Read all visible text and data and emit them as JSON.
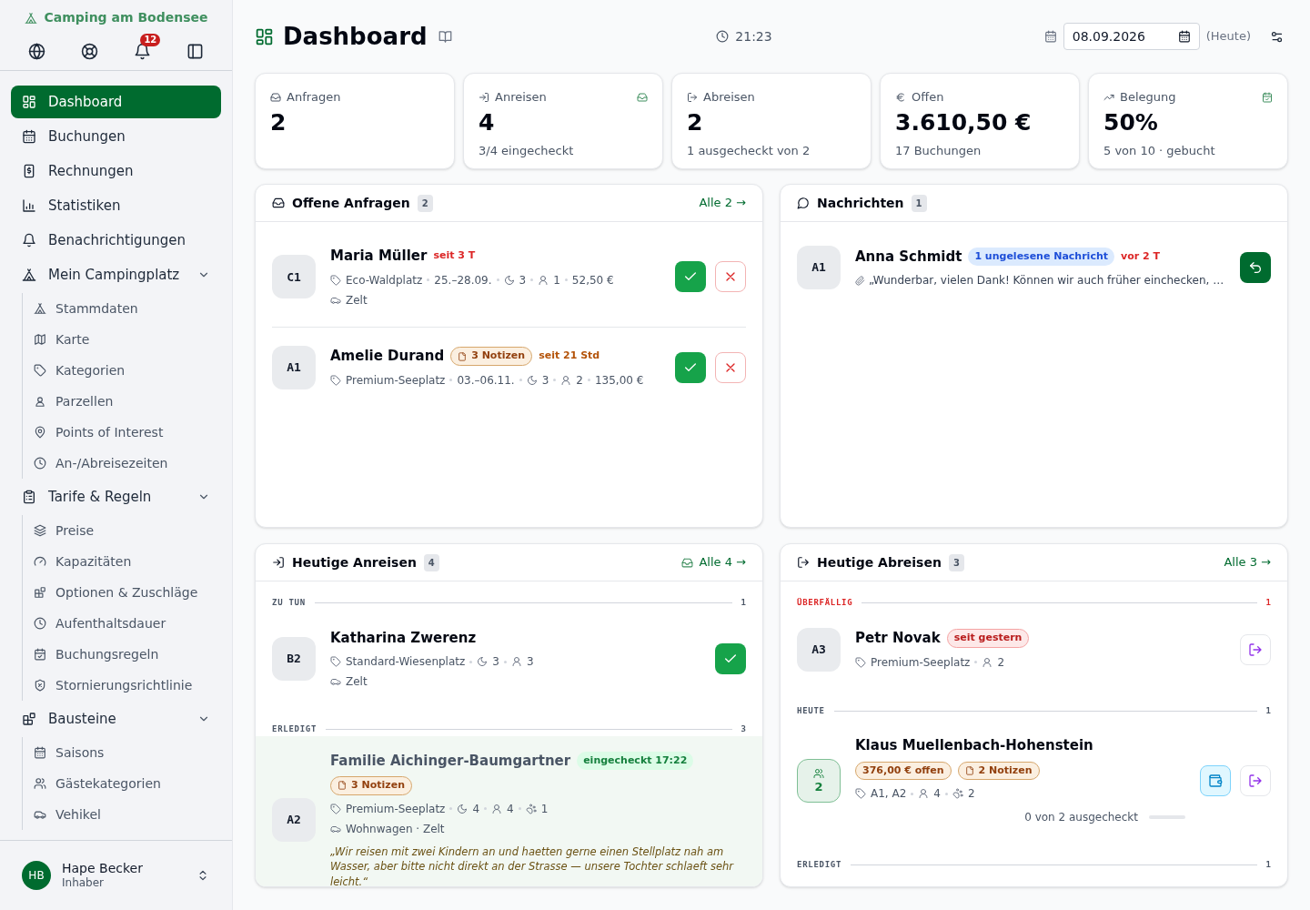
{
  "sidebar": {
    "brand": "Camping am Bodensee",
    "notification_count": "12",
    "nav": [
      {
        "label": "Dashboard",
        "selected": true
      },
      {
        "label": "Buchungen",
        "selected": false
      },
      {
        "label": "Rechnungen",
        "selected": false
      },
      {
        "label": "Statistiken",
        "selected": false
      },
      {
        "label": "Benachrichtigungen",
        "selected": false
      },
      {
        "label": "Mein Campingplatz",
        "selected": false,
        "expanded": true,
        "children": [
          {
            "label": "Stammdaten",
            "selected": false
          },
          {
            "label": "Karte",
            "selected": false
          },
          {
            "label": "Kategorien",
            "selected": false
          },
          {
            "label": "Parzellen",
            "selected": false
          },
          {
            "label": "Points of Interest",
            "selected": false
          },
          {
            "label": "An-/Abreisezeiten",
            "selected": false
          }
        ]
      },
      {
        "label": "Tarife & Regeln",
        "selected": false,
        "expanded": true,
        "children": [
          {
            "label": "Preise",
            "selected": false
          },
          {
            "label": "Kapazitäten",
            "selected": false
          },
          {
            "label": "Optionen & Zuschläge",
            "selected": false
          },
          {
            "label": "Aufenthaltsdauer",
            "selected": false
          },
          {
            "label": "Buchungsregeln",
            "selected": false
          },
          {
            "label": "Stornierungsrichtlinie",
            "selected": false
          }
        ]
      },
      {
        "label": "Bausteine",
        "selected": false,
        "expanded": true,
        "children": [
          {
            "label": "Saisons",
            "selected": false
          },
          {
            "label": "Gästekategorien",
            "selected": false
          },
          {
            "label": "Vehikel",
            "selected": false
          }
        ]
      }
    ],
    "user": {
      "initials": "HB",
      "name": "Hape Becker",
      "role": "Inhaber"
    }
  },
  "header": {
    "title": "Dashboard",
    "time": "21:23",
    "date": "08.09.2026",
    "date_note": "(Heute)"
  },
  "stats": [
    {
      "label": "Anfragen",
      "value": "2"
    },
    {
      "label": "Anreisen",
      "value": "4",
      "note": "3/4 eingecheckt"
    },
    {
      "label": "Abreisen",
      "value": "2",
      "note": "1 ausgecheckt von 2"
    },
    {
      "label": "Offen",
      "value": "3.610,50 €",
      "note": "17 Buchungen"
    },
    {
      "label": "Belegung",
      "value": "50%",
      "note": "5 von 10 · gebucht"
    }
  ],
  "panels": [
    {
      "kind": "requests",
      "title": "Offene Anfragen",
      "count": "2",
      "link": "Alle 2 →",
      "sections": [
        {
          "items": [
            {
              "spot": "C1",
              "group": false,
              "name": "Maria Müller",
              "done": false,
              "badges": [
                {
                  "kind": "urgent",
                  "text": "seit 3 T"
                }
              ],
              "meta": [
                {
                  "kind": "category",
                  "text": "Eco-Waldplatz"
                },
                {
                  "kind": "dates",
                  "text": "25.–28.09."
                },
                {
                  "kind": "nights",
                  "text": "3"
                },
                {
                  "kind": "persons",
                  "text": "1"
                },
                {
                  "kind": "price",
                  "text": "52,50 €"
                }
              ],
              "vehicle": "Zelt",
              "actions": [
                {
                  "kind": "accept"
                },
                {
                  "kind": "reject"
                }
              ]
            },
            {
              "spot": "A1",
              "group": false,
              "name": "Amelie Durand",
              "done": false,
              "badges": [
                {
                  "kind": "notes",
                  "text": "3 Notizen"
                },
                {
                  "kind": "pending",
                  "text": "seit 21 Std"
                }
              ],
              "meta": [
                {
                  "kind": "category",
                  "text": "Premium-Seeplatz"
                },
                {
                  "kind": "dates",
                  "text": "03.–06.11."
                },
                {
                  "kind": "nights",
                  "text": "3"
                },
                {
                  "kind": "persons",
                  "text": "2"
                },
                {
                  "kind": "price",
                  "text": "135,00 €"
                }
              ],
              "actions": [
                {
                  "kind": "accept"
                },
                {
                  "kind": "reject"
                }
              ]
            }
          ]
        }
      ]
    },
    {
      "kind": "messages",
      "title": "Nachrichten",
      "count": "1",
      "sections": [
        {
          "items": [
            {
              "spot": "A1",
              "group": false,
              "name": "Anna Schmidt",
              "done": false,
              "badges": [
                {
                  "kind": "unread",
                  "text": "1 ungelesene Nachricht"
                },
                {
                  "kind": "urgent",
                  "text": "vor 2 T"
                }
              ],
              "message": "„Wunderbar, vielen Dank! Können wir auch früher einchecken, …",
              "actions": [
                {
                  "kind": "reply"
                }
              ]
            }
          ]
        }
      ]
    },
    {
      "kind": "arrivals",
      "title": "Heutige Anreisen",
      "count": "4",
      "link": "Alle 4 →",
      "sections": [
        {
          "label": "ZU TUN",
          "count": "1",
          "alert": false,
          "items": [
            {
              "spot": "B2",
              "group": false,
              "name": "Katharina Zwerenz",
              "done": false,
              "meta": [
                {
                  "kind": "category",
                  "text": "Standard-Wiesenplatz"
                },
                {
                  "kind": "nights",
                  "text": "3"
                },
                {
                  "kind": "persons",
                  "text": "3"
                }
              ],
              "vehicle": "Zelt",
              "actions": [
                {
                  "kind": "checkin"
                }
              ]
            }
          ]
        },
        {
          "label": "ERLEDIGT",
          "count": "3",
          "alert": false,
          "items": [
            {
              "spot": "A2",
              "group": false,
              "name": "Familie Aichinger-Baumgartner",
              "done": true,
              "badges": [
                {
                  "kind": "checkedin",
                  "text": "eingecheckt 17:22"
                },
                {
                  "kind": "notes",
                  "text": "3 Notizen"
                }
              ],
              "meta": [
                {
                  "kind": "category",
                  "text": "Premium-Seeplatz"
                },
                {
                  "kind": "nights",
                  "text": "4"
                },
                {
                  "kind": "persons",
                  "text": "4"
                },
                {
                  "kind": "pets",
                  "text": "1"
                }
              ],
              "vehicle": "Wohnwagen · Zelt",
              "quote": "„Wir reisen mit zwei Kindern an und haetten gerne einen Stellplatz nah am Wasser, aber bitte nicht direkt an der Strasse — unsere Tochter schlaeft sehr leicht.“"
            }
          ]
        }
      ]
    },
    {
      "kind": "departures",
      "title": "Heutige Abreisen",
      "count": "3",
      "link": "Alle 3 →",
      "sections": [
        {
          "label": "ÜBERFÄLLIG",
          "count": "1",
          "alert": true,
          "items": [
            {
              "spot": "A3",
              "group": false,
              "name": "Petr Novak",
              "done": false,
              "badges": [
                {
                  "kind": "overdue",
                  "text": "seit gestern"
                }
              ],
              "meta": [
                {
                  "kind": "category",
                  "text": "Premium-Seeplatz"
                },
                {
                  "kind": "persons",
                  "text": "2"
                }
              ],
              "actions": [
                {
                  "kind": "checkout"
                }
              ]
            }
          ]
        },
        {
          "label": "HEUTE",
          "count": "1",
          "alert": false,
          "items": [
            {
              "spot": "2",
              "group": true,
              "name": "Klaus Muellenbach-Hohenstein",
              "done": false,
              "badges": [
                {
                  "kind": "open",
                  "text": "376,00 € offen"
                },
                {
                  "kind": "notes",
                  "text": "2 Notizen"
                }
              ],
              "meta": [
                {
                  "kind": "category",
                  "text": "A1, A2"
                },
                {
                  "kind": "persons",
                  "text": "4"
                },
                {
                  "kind": "pets",
                  "text": "2"
                }
              ],
              "actions": [
                {
                  "kind": "wallet"
                },
                {
                  "kind": "checkout"
                }
              ],
              "progress": {
                "text": "0 von 2 ausgecheckt",
                "level": 0
              }
            }
          ]
        },
        {
          "label": "ERLEDIGT",
          "count": "1",
          "alert": false
        }
      ]
    }
  ]
}
